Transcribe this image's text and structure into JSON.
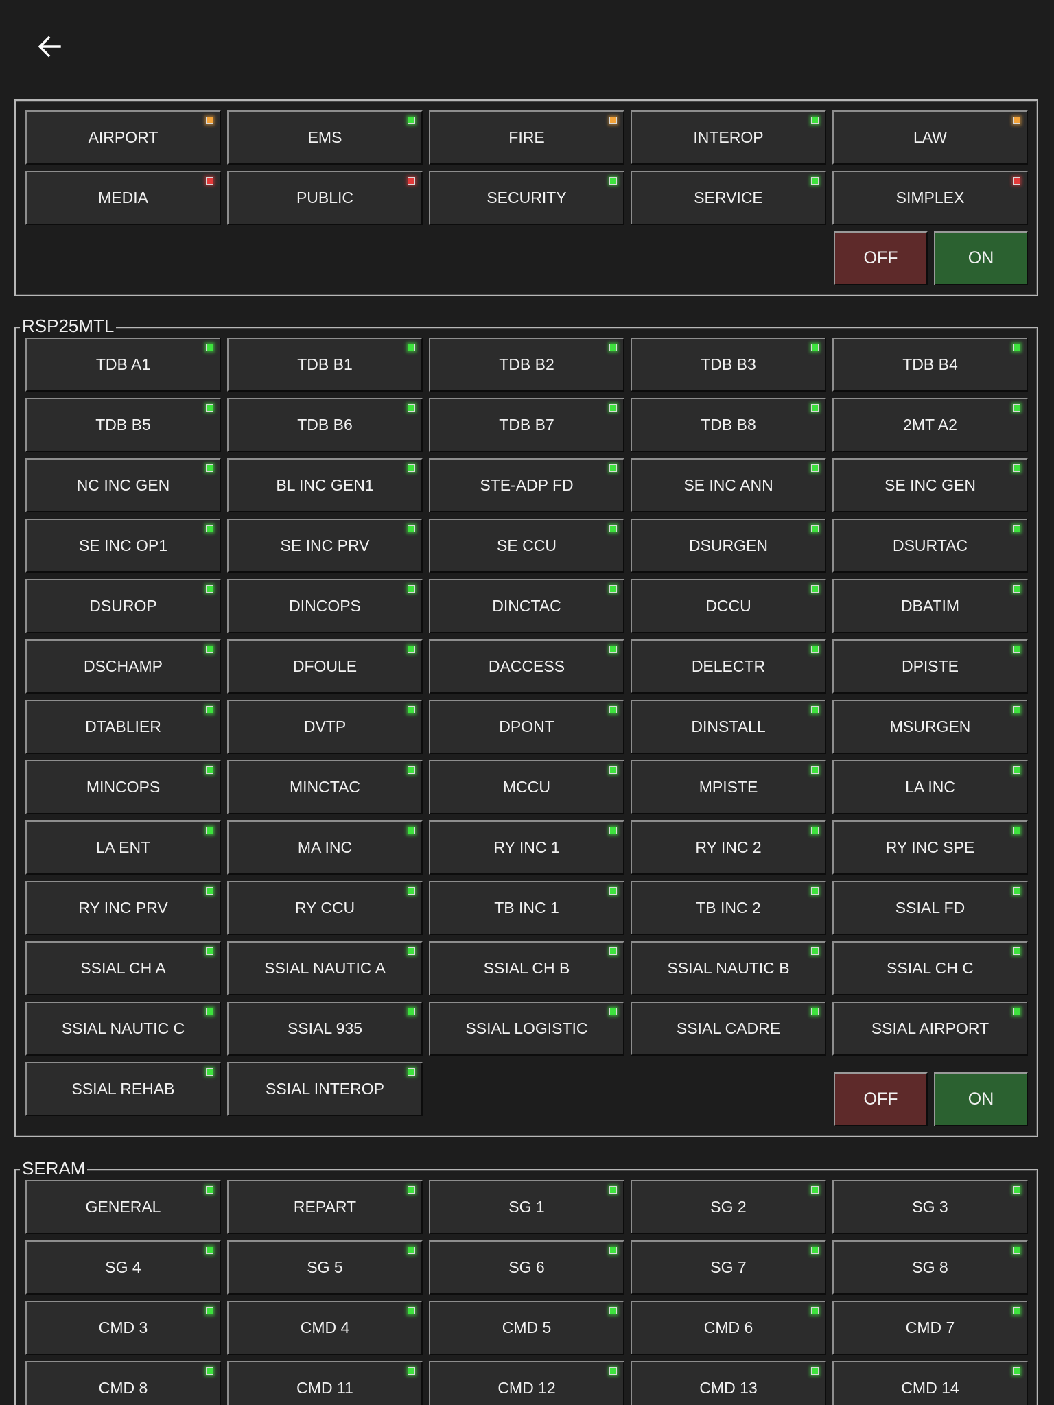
{
  "header": {
    "back_icon": "arrow-left-icon"
  },
  "led_colors": {
    "green": "#3ee23e",
    "orange": "#f3a33a",
    "red": "#e33a3a"
  },
  "groups": [
    {
      "title": "",
      "off_label": "OFF",
      "on_label": "ON",
      "channels": [
        {
          "label": "AIRPORT",
          "status": "orange"
        },
        {
          "label": "EMS",
          "status": "green"
        },
        {
          "label": "FIRE",
          "status": "orange"
        },
        {
          "label": "INTEROP",
          "status": "green"
        },
        {
          "label": "LAW",
          "status": "orange"
        },
        {
          "label": "MEDIA",
          "status": "red"
        },
        {
          "label": "PUBLIC",
          "status": "red"
        },
        {
          "label": "SECURITY",
          "status": "green"
        },
        {
          "label": "SERVICE",
          "status": "green"
        },
        {
          "label": "SIMPLEX",
          "status": "red"
        }
      ]
    },
    {
      "title": "RSP25MTL",
      "off_label": "OFF",
      "on_label": "ON",
      "channels": [
        {
          "label": "TDB A1",
          "status": "green"
        },
        {
          "label": "TDB B1",
          "status": "green"
        },
        {
          "label": "TDB B2",
          "status": "green"
        },
        {
          "label": "TDB B3",
          "status": "green"
        },
        {
          "label": "TDB B4",
          "status": "green"
        },
        {
          "label": "TDB B5",
          "status": "green"
        },
        {
          "label": "TDB B6",
          "status": "green"
        },
        {
          "label": "TDB B7",
          "status": "green"
        },
        {
          "label": "TDB B8",
          "status": "green"
        },
        {
          "label": "2MT A2",
          "status": "green"
        },
        {
          "label": "NC INC GEN",
          "status": "green"
        },
        {
          "label": "BL INC GEN1",
          "status": "green"
        },
        {
          "label": "STE-ADP FD",
          "status": "green"
        },
        {
          "label": "SE INC ANN",
          "status": "green"
        },
        {
          "label": "SE INC GEN",
          "status": "green"
        },
        {
          "label": "SE INC OP1",
          "status": "green"
        },
        {
          "label": "SE INC PRV",
          "status": "green"
        },
        {
          "label": "SE CCU",
          "status": "green"
        },
        {
          "label": "DSURGEN",
          "status": "green"
        },
        {
          "label": "DSURTAC",
          "status": "green"
        },
        {
          "label": "DSUROP",
          "status": "green"
        },
        {
          "label": "DINCOPS",
          "status": "green"
        },
        {
          "label": "DINCTAC",
          "status": "green"
        },
        {
          "label": "DCCU",
          "status": "green"
        },
        {
          "label": "DBATIM",
          "status": "green"
        },
        {
          "label": "DSCHAMP",
          "status": "green"
        },
        {
          "label": "DFOULE",
          "status": "green"
        },
        {
          "label": "DACCESS",
          "status": "green"
        },
        {
          "label": "DELECTR",
          "status": "green"
        },
        {
          "label": "DPISTE",
          "status": "green"
        },
        {
          "label": "DTABLIER",
          "status": "green"
        },
        {
          "label": "DVTP",
          "status": "green"
        },
        {
          "label": "DPONT",
          "status": "green"
        },
        {
          "label": "DINSTALL",
          "status": "green"
        },
        {
          "label": "MSURGEN",
          "status": "green"
        },
        {
          "label": "MINCOPS",
          "status": "green"
        },
        {
          "label": "MINCTAC",
          "status": "green"
        },
        {
          "label": "MCCU",
          "status": "green"
        },
        {
          "label": "MPISTE",
          "status": "green"
        },
        {
          "label": "LA INC",
          "status": "green"
        },
        {
          "label": "LA ENT",
          "status": "green"
        },
        {
          "label": "MA INC",
          "status": "green"
        },
        {
          "label": "RY INC 1",
          "status": "green"
        },
        {
          "label": "RY INC 2",
          "status": "green"
        },
        {
          "label": "RY INC SPE",
          "status": "green"
        },
        {
          "label": "RY INC PRV",
          "status": "green"
        },
        {
          "label": "RY CCU",
          "status": "green"
        },
        {
          "label": "TB INC 1",
          "status": "green"
        },
        {
          "label": "TB INC 2",
          "status": "green"
        },
        {
          "label": "SSIAL FD",
          "status": "green"
        },
        {
          "label": "SSIAL CH A",
          "status": "green"
        },
        {
          "label": "SSIAL NAUTIC A",
          "status": "green"
        },
        {
          "label": "SSIAL CH B",
          "status": "green"
        },
        {
          "label": "SSIAL NAUTIC B",
          "status": "green"
        },
        {
          "label": "SSIAL CH C",
          "status": "green"
        },
        {
          "label": "SSIAL NAUTIC C",
          "status": "green"
        },
        {
          "label": "SSIAL 935",
          "status": "green"
        },
        {
          "label": "SSIAL LOGISTIC",
          "status": "green"
        },
        {
          "label": "SSIAL CADRE",
          "status": "green"
        },
        {
          "label": "SSIAL AIRPORT",
          "status": "green"
        },
        {
          "label": "SSIAL REHAB",
          "status": "green"
        },
        {
          "label": "SSIAL INTEROP",
          "status": "green"
        }
      ]
    },
    {
      "title": "SERAM",
      "off_label": "",
      "on_label": "",
      "channels": [
        {
          "label": "GENERAL",
          "status": "green"
        },
        {
          "label": "REPART",
          "status": "green"
        },
        {
          "label": "SG 1",
          "status": "green"
        },
        {
          "label": "SG 2",
          "status": "green"
        },
        {
          "label": "SG 3",
          "status": "green"
        },
        {
          "label": "SG 4",
          "status": "green"
        },
        {
          "label": "SG 5",
          "status": "green"
        },
        {
          "label": "SG 6",
          "status": "green"
        },
        {
          "label": "SG 7",
          "status": "green"
        },
        {
          "label": "SG 8",
          "status": "green"
        },
        {
          "label": "CMD 3",
          "status": "green"
        },
        {
          "label": "CMD 4",
          "status": "green"
        },
        {
          "label": "CMD 5",
          "status": "green"
        },
        {
          "label": "CMD 6",
          "status": "green"
        },
        {
          "label": "CMD 7",
          "status": "green"
        },
        {
          "label": "CMD 8",
          "status": "green"
        },
        {
          "label": "CMD 11",
          "status": "green"
        },
        {
          "label": "CMD 12",
          "status": "green"
        },
        {
          "label": "CMD 13",
          "status": "green"
        },
        {
          "label": "CMD 14",
          "status": "green"
        }
      ]
    }
  ]
}
